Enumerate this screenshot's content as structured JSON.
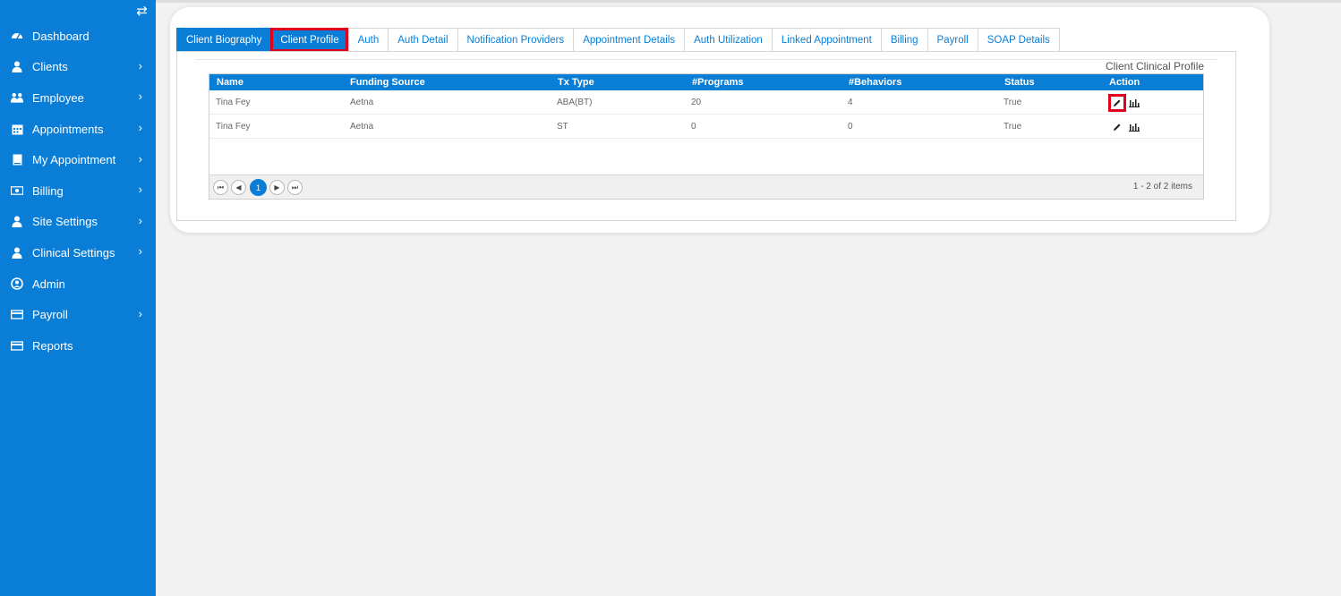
{
  "sidebar": {
    "toggle_glyph": "⇄",
    "items": [
      {
        "label": "Dashboard",
        "icon": "dashboard-icon",
        "has_chevron": false
      },
      {
        "label": "Clients",
        "icon": "user-icon",
        "has_chevron": true
      },
      {
        "label": "Employee",
        "icon": "users-icon",
        "has_chevron": true
      },
      {
        "label": "Appointments",
        "icon": "calendar-icon",
        "has_chevron": true
      },
      {
        "label": "My Appointment",
        "icon": "book-icon",
        "has_chevron": true
      },
      {
        "label": "Billing",
        "icon": "money-icon",
        "has_chevron": true
      },
      {
        "label": "Site Settings",
        "icon": "user-icon",
        "has_chevron": true
      },
      {
        "label": "Clinical Settings",
        "icon": "user-icon",
        "has_chevron": true
      },
      {
        "label": "Admin",
        "icon": "user-circle-icon",
        "has_chevron": false
      },
      {
        "label": "Payroll",
        "icon": "card-icon",
        "has_chevron": true
      },
      {
        "label": "Reports",
        "icon": "card-icon",
        "has_chevron": false
      }
    ]
  },
  "tabs": [
    {
      "label": "Client Biography",
      "state": "active"
    },
    {
      "label": "Client Profile",
      "state": "selected"
    },
    {
      "label": "Auth",
      "state": ""
    },
    {
      "label": "Auth Detail",
      "state": ""
    },
    {
      "label": "Notification Providers",
      "state": ""
    },
    {
      "label": "Appointment Details",
      "state": ""
    },
    {
      "label": "Auth Utilization",
      "state": ""
    },
    {
      "label": "Linked Appointment",
      "state": ""
    },
    {
      "label": "Billing",
      "state": ""
    },
    {
      "label": "Payroll",
      "state": ""
    },
    {
      "label": "SOAP Details",
      "state": ""
    }
  ],
  "panel": {
    "title": "Client Clinical Profile"
  },
  "grid": {
    "columns": [
      "Name",
      "Funding Source",
      "Tx Type",
      "#Programs",
      "#Behaviors",
      "Status",
      "Action"
    ],
    "rows": [
      {
        "name": "Tina Fey",
        "funding": "Aetna",
        "tx": "ABA(BT)",
        "programs": "20",
        "behaviors": "4",
        "status": "True"
      },
      {
        "name": "Tina Fey",
        "funding": "Aetna",
        "tx": "ST",
        "programs": "0",
        "behaviors": "0",
        "status": "True"
      }
    ],
    "pager": {
      "first": "⏮",
      "prev": "◀",
      "current": "1",
      "next": "▶",
      "last": "⏭",
      "info": "1 - 2 of 2 items"
    }
  },
  "colors": {
    "primary": "#0a7ed6",
    "highlight": "#e0001b"
  }
}
